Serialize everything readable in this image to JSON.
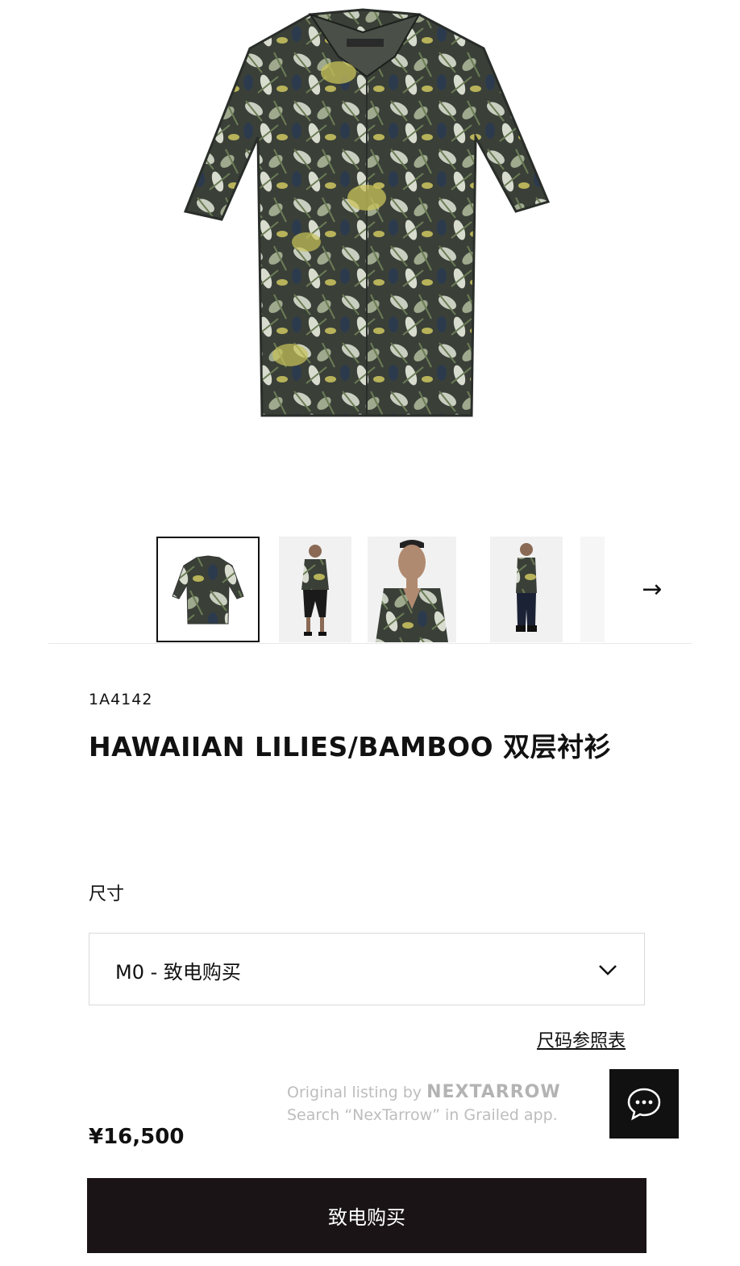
{
  "gallery": {
    "next_arrow": "→",
    "thumbnails": [
      "shirt-flat",
      "model-full",
      "model-closeup",
      "model-side"
    ],
    "active_index": 0
  },
  "product": {
    "sku": "1A4142",
    "title": "HAWAIIAN LILIES/BAMBOO 双层衬衫",
    "price": "¥16,500"
  },
  "size": {
    "label": "尺寸",
    "selected": "M0 - 致电购买",
    "guide_link": "尺码参照表"
  },
  "watermark": {
    "line1_prefix": "Original listing by",
    "brand": "NEXTARROW",
    "line2": "Search “NexTarrow” in Grailed app."
  },
  "actions": {
    "buy_label": "致电购买",
    "chat_icon": "chat-bubble-icon"
  },
  "colors": {
    "button_bg": "#1a1416",
    "text": "#111111"
  }
}
